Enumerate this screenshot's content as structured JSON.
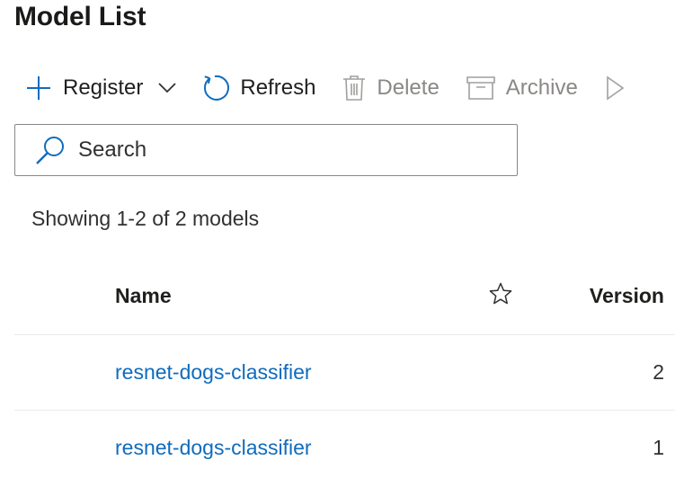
{
  "page": {
    "title": "Model List"
  },
  "toolbar": {
    "register_label": "Register",
    "refresh_label": "Refresh",
    "delete_label": "Delete",
    "archive_label": "Archive"
  },
  "search": {
    "placeholder": "Search",
    "value": ""
  },
  "results": {
    "summary": "Showing 1-2 of 2 models"
  },
  "table": {
    "headers": {
      "name": "Name",
      "version": "Version"
    },
    "rows": [
      {
        "name": "resnet-dogs-classifier",
        "version": "2"
      },
      {
        "name": "resnet-dogs-classifier",
        "version": "1"
      }
    ]
  },
  "colors": {
    "accent": "#0f6cbd",
    "disabled": "#8a8886"
  },
  "icons": {
    "register": "plus-icon",
    "register_menu": "chevron-down-icon",
    "refresh": "refresh-icon",
    "delete": "trash-icon",
    "archive": "archive-icon",
    "more": "play-icon",
    "search": "search-icon",
    "favorite": "star-icon"
  }
}
